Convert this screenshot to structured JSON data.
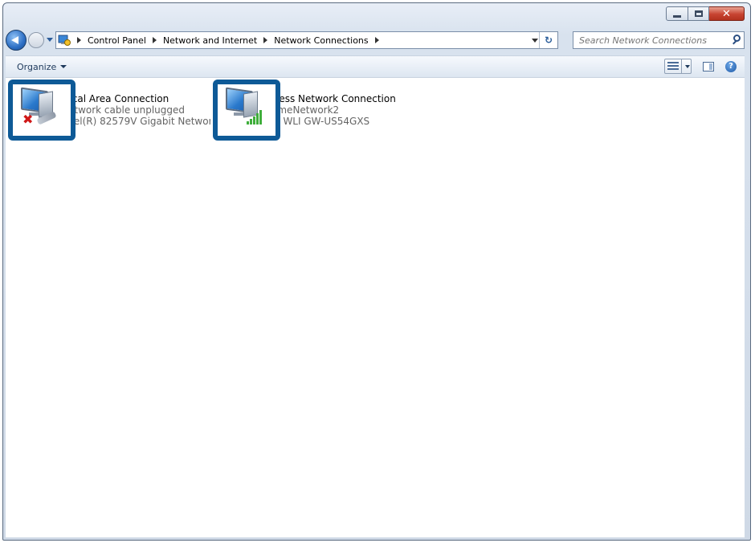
{
  "window": {
    "caption_buttons": {
      "close_glyph": "✕"
    }
  },
  "address_bar": {
    "crumbs": [
      "Control Panel",
      "Network and Internet",
      "Network Connections"
    ],
    "refresh_glyph": "↻"
  },
  "search": {
    "placeholder": "Search Network Connections"
  },
  "toolbar": {
    "organize_label": "Organize",
    "help_glyph": "?"
  },
  "connections": [
    {
      "name": "Local Area Connection",
      "status": "Network cable unplugged",
      "device": "Intel(R) 82579V Gigabit Network Connection",
      "icon": "wired-network-disconnected-icon"
    },
    {
      "name": "Wireless Network Connection",
      "status": "HomeNetwork2",
      "device": "BUFFALO WLI GW-US54GXS",
      "icon": "wireless-network-signal-icon"
    }
  ],
  "colors": {
    "highlight_border": "#0e5a97",
    "signal_green": "#3fae3b",
    "error_red": "#d01818"
  }
}
